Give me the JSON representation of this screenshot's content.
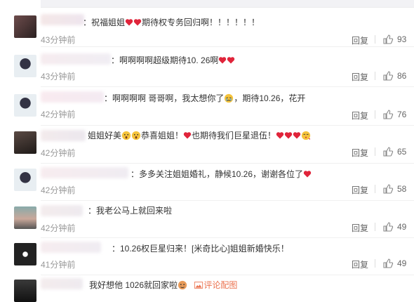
{
  "comments": [
    {
      "text": "：祝福姐姐",
      "text_after": "期待权专务回归啊！！！！！！",
      "time": "43分钟前",
      "reply": "回复",
      "likes": "93"
    },
    {
      "text": "：啊啊啊啊超级期待10. 26啊",
      "text_after": "",
      "time": "43分钟前",
      "reply": "回复",
      "likes": "86"
    },
    {
      "text": "：啊啊啊啊 哥哥啊，我太想你了",
      "text_after": "，期待10.26，花开",
      "time": "42分钟前",
      "reply": "回复",
      "likes": "76"
    },
    {
      "text": "姐姐好美",
      "text_after": "恭喜姐姐！",
      "text_after2": "也期待我们巨星退伍！",
      "time": "42分钟前",
      "reply": "回复",
      "likes": "65"
    },
    {
      "text": "：多多关注姐姐婚礼，静候10.26，谢谢各位了",
      "text_after": "",
      "time": "42分钟前",
      "reply": "回复",
      "likes": "58"
    },
    {
      "text": "：我老公马上就回来啦",
      "text_after": "",
      "time": "42分钟前",
      "reply": "回复",
      "likes": "49"
    },
    {
      "text": "：10.26权巨星归来！[米奇比心]姐姐新婚快乐！",
      "text_after": "",
      "time": "41分钟前",
      "reply": "回复",
      "likes": "49"
    },
    {
      "text": "我好想他 1026就回家啦",
      "text_after": "",
      "pic_link": "评论配图",
      "time": "",
      "reply": "",
      "likes": ""
    }
  ],
  "colors": {
    "heart": "#e0243a",
    "link": "#eb7350",
    "muted": "#999999"
  },
  "icons": [
    "thumb-up-icon",
    "heart-icon",
    "picture-icon"
  ]
}
